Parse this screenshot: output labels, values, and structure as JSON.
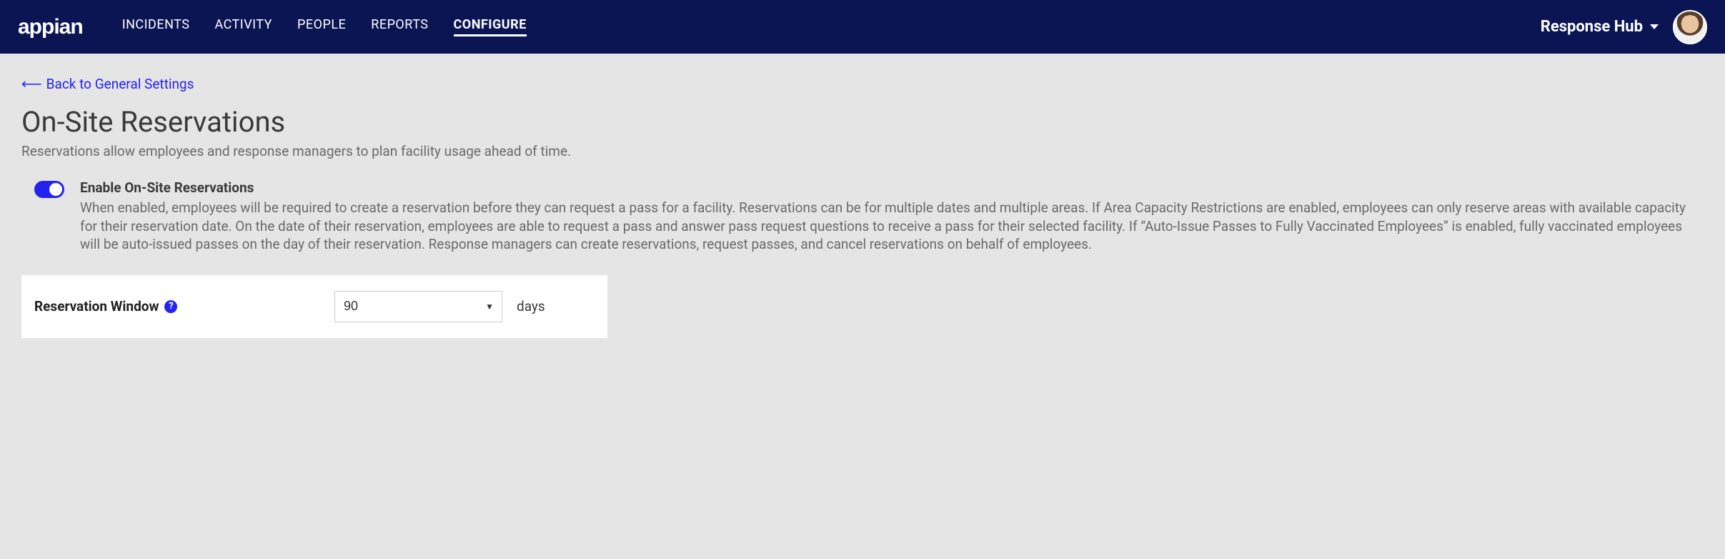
{
  "brand": "appian",
  "nav": {
    "items": [
      {
        "label": "INCIDENTS",
        "active": false
      },
      {
        "label": "ACTIVITY",
        "active": false
      },
      {
        "label": "PEOPLE",
        "active": false
      },
      {
        "label": "REPORTS",
        "active": false
      },
      {
        "label": "CONFIGURE",
        "active": true
      }
    ]
  },
  "site_dropdown": {
    "label": "Response Hub"
  },
  "back_link": {
    "label": "Back to General Settings"
  },
  "page": {
    "title": "On-Site Reservations",
    "subtitle": "Reservations allow employees and response managers to plan facility usage ahead of time."
  },
  "enable_setting": {
    "title": "Enable On-Site Reservations",
    "description": "When enabled, employees will be required to create a reservation before they can request a pass for a facility. Reservations can be for multiple dates and multiple areas. If Area Capacity Restrictions are enabled, employees can only reserve areas with available capacity for their reservation date. On the date of their reservation, employees are able to request a pass and answer pass request questions to receive a pass for their selected facility. If “Auto-Issue Passes to Fully Vaccinated Employees” is enabled, fully vaccinated employees will be auto-issued passes on the day of their reservation. Response managers can create reservations, request passes, and cancel reservations on behalf of employees.",
    "enabled": true
  },
  "reservation_window": {
    "label": "Reservation Window",
    "value": "90",
    "unit": "days"
  }
}
